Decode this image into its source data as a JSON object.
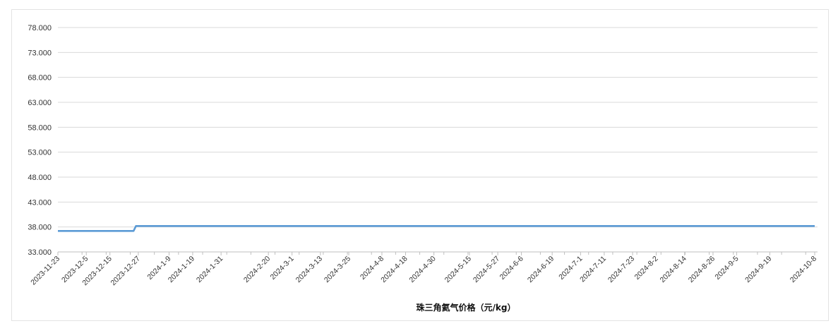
{
  "chart_data": {
    "type": "line",
    "title": "",
    "xlabel": "珠三角氦气价格（元/kg）",
    "ylabel": "",
    "ylim": [
      33,
      78
    ],
    "yticks": [
      "78.000",
      "73.000",
      "68.000",
      "63.000",
      "58.000",
      "53.000",
      "48.000",
      "43.000",
      "38.000",
      "33.000"
    ],
    "ytick_values": [
      78,
      73,
      68,
      63,
      58,
      53,
      48,
      43,
      38,
      33
    ],
    "xtick_labels": [
      "2023-11-23",
      "2023-12-5",
      "2023-12-15",
      "2023-12-27",
      "2024-1-9",
      "2024-1-19",
      "2024-1-31",
      "2024-2-20",
      "2024-3-1",
      "2024-3-13",
      "2024-3-25",
      "2024-4-8",
      "2024-4-18",
      "2024-4-30",
      "2024-5-15",
      "2024-5-27",
      "2024-6-6",
      "2024-6-19",
      "2024-7-1",
      "2024-7-11",
      "2024-7-23",
      "2024-8-2",
      "2024-8-14",
      "2024-8-26",
      "2024-9-5",
      "2024-9-19",
      "2024-10-8"
    ],
    "grid": true,
    "legend": "none",
    "series": [
      {
        "color": "#5b9bd5",
        "points": [
          {
            "x": "2023-11-23",
            "y": 37.2
          },
          {
            "x": "2023-12-25",
            "y": 37.2
          },
          {
            "x": "2023-12-26",
            "y": 38.2
          },
          {
            "x": "2024-10-8",
            "y": 38.2
          }
        ]
      }
    ]
  }
}
